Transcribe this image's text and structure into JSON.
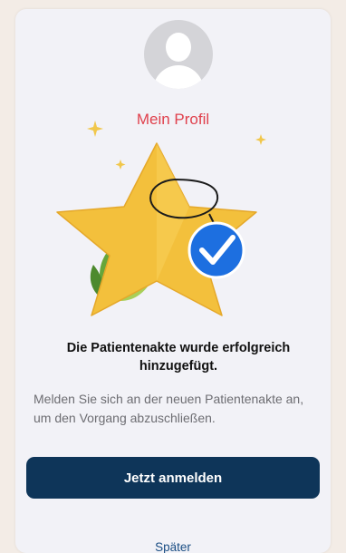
{
  "profile": {
    "label": "Mein Profil"
  },
  "message": {
    "title": "Die Patientenakte wurde erfolgreich hinzugefügt.",
    "body": "Melden Sie sich an der neuen Patientenakte an, um den Vorgang abzuschließen."
  },
  "actions": {
    "primary_label": "Jetzt anmelden",
    "secondary_label": "Später"
  },
  "icons": {
    "avatar": "user-avatar-icon",
    "illustration": "star-with-checkmark-badge",
    "check": "checkmark-icon"
  },
  "colors": {
    "accent_red": "#e0414d",
    "button_navy": "#0e3559",
    "link_blue": "#1b4e84",
    "badge_blue": "#1d6fe0",
    "star_yellow": "#f3c03c"
  }
}
